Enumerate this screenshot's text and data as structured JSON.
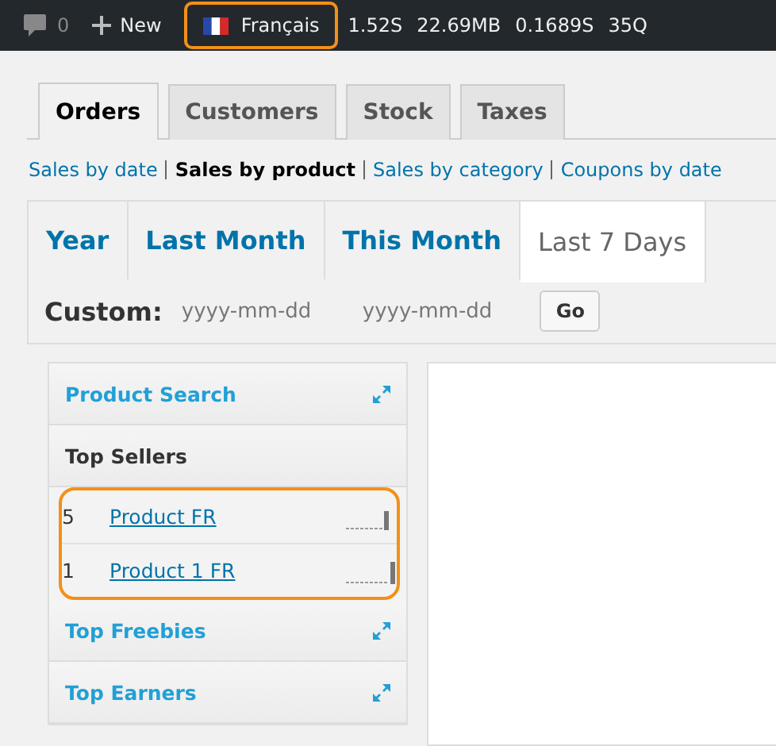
{
  "admin_bar": {
    "comments_count": "0",
    "new_label": "New",
    "language": {
      "label": "Français",
      "highlighted": true
    },
    "stats": [
      "1.52S",
      "22.69MB",
      "0.1689S",
      "35Q"
    ]
  },
  "tabs": [
    {
      "label": "Orders",
      "selected": true
    },
    {
      "label": "Customers",
      "selected": false
    },
    {
      "label": "Stock",
      "selected": false
    },
    {
      "label": "Taxes",
      "selected": false
    }
  ],
  "subnav": [
    {
      "label": "Sales by date",
      "selected": false
    },
    {
      "label": "Sales by product",
      "selected": true
    },
    {
      "label": "Sales by category",
      "selected": false
    },
    {
      "label": "Coupons by date",
      "selected": false
    }
  ],
  "ranges": [
    {
      "label": "Year",
      "selected": false
    },
    {
      "label": "Last Month",
      "selected": false
    },
    {
      "label": "This Month",
      "selected": false
    },
    {
      "label": "Last 7 Days",
      "selected": true
    }
  ],
  "custom": {
    "label": "Custom:",
    "from": {
      "placeholder": "yyyy-mm-dd"
    },
    "to": {
      "placeholder": "yyyy-mm-dd"
    },
    "button": "Go"
  },
  "sidebar": [
    {
      "kind": "collapsible",
      "title": "Product Search"
    },
    {
      "kind": "list",
      "title": "Top Sellers",
      "highlighted": true,
      "rows": [
        {
          "count": "5",
          "product": "Product FR"
        },
        {
          "count": "1",
          "product": "Product 1 FR"
        }
      ]
    },
    {
      "kind": "collapsible",
      "title": "Top Freebies"
    },
    {
      "kind": "collapsible",
      "title": "Top Earners"
    }
  ]
}
